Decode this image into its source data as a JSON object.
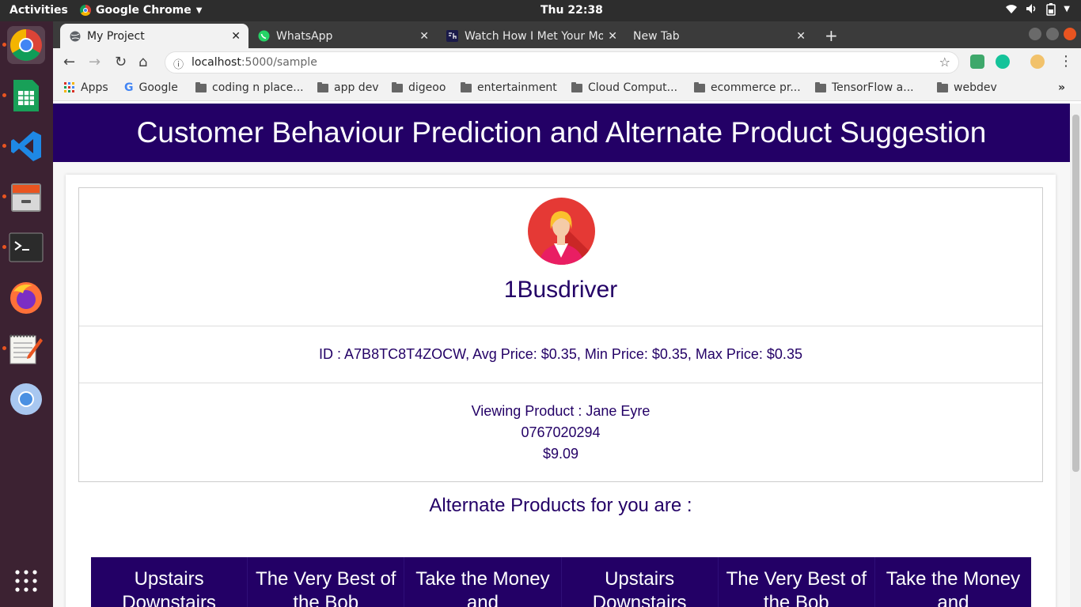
{
  "system": {
    "activities": "Activities",
    "app_name": "Google Chrome",
    "clock": "Thu 22:38"
  },
  "browser": {
    "tabs": [
      {
        "title": "My Project",
        "icon": "globe-icon",
        "active": true
      },
      {
        "title": "WhatsApp",
        "icon": "whatsapp-icon",
        "active": false
      },
      {
        "title": "Watch How I Met Your Mo",
        "icon": "bh-icon",
        "active": false
      },
      {
        "title": "New Tab",
        "icon": "",
        "active": false
      }
    ],
    "url_host": "localhost",
    "url_path": ":5000/sample",
    "bookmarks": [
      {
        "label": "Apps",
        "icon": "apps-grid-icon"
      },
      {
        "label": "Google",
        "icon": "google-icon"
      },
      {
        "label": "coding n place...",
        "icon": "folder-icon"
      },
      {
        "label": "app dev",
        "icon": "folder-icon"
      },
      {
        "label": "digeoo",
        "icon": "folder-icon"
      },
      {
        "label": "entertainment",
        "icon": "folder-icon"
      },
      {
        "label": "Cloud Comput...",
        "icon": "folder-icon"
      },
      {
        "label": "ecommerce pr...",
        "icon": "folder-icon"
      },
      {
        "label": "TensorFlow a...",
        "icon": "folder-icon"
      },
      {
        "label": "webdev",
        "icon": "folder-icon"
      }
    ]
  },
  "page": {
    "banner_title": "Customer Behaviour Prediction and Alternate Product Suggestion",
    "username": "1Busdriver",
    "id_line": "ID : A7B8TC8T4ZOCW, Avg Price: $0.35, Min Price: $0.35, Max Price: $0.35",
    "viewing_product": "Viewing Product : Jane Eyre",
    "product_code": "0767020294",
    "product_price": "$9.09",
    "alternate_heading": "Alternate Products for you are :",
    "alternate_products": [
      "Upstairs Downstairs",
      "The Very Best of the Bob",
      "Take the Money and",
      "Upstairs Downstairs",
      "The Very Best of the Bob",
      "Take the Money and"
    ]
  },
  "colors": {
    "brand": "#230066",
    "accent": "#e95420"
  }
}
